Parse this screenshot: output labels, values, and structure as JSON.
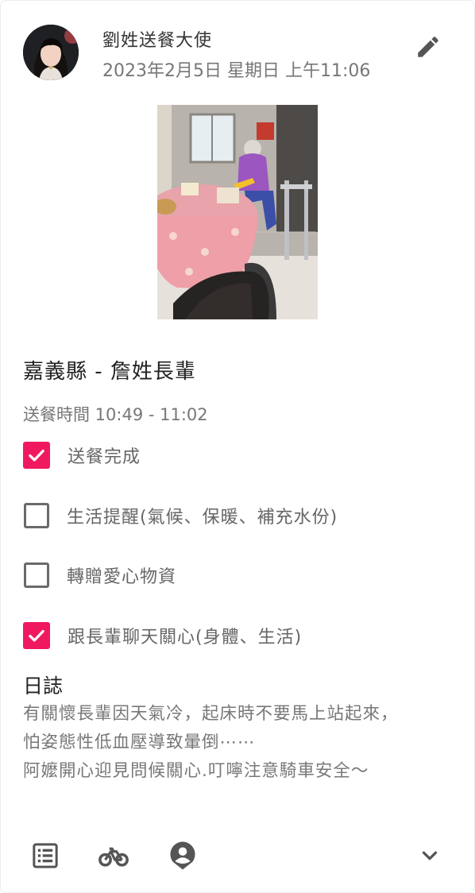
{
  "post": {
    "author": "劉姓送餐大使",
    "date": "2023年2月5日 星期日 上午11:06",
    "title": "嘉義縣 - 詹姓長輩",
    "delivery_time": "送餐時間 10:49 - 11:02"
  },
  "tasks": [
    {
      "label": "送餐完成",
      "checked": true
    },
    {
      "label": "生活提醒(氣候、保暖、補充水份)",
      "checked": false
    },
    {
      "label": "轉贈愛心物資",
      "checked": false
    },
    {
      "label": "跟長輩聊天關心(身體、生活)",
      "checked": true
    }
  ],
  "notes": {
    "heading": "日誌",
    "lines": [
      "有關懷長輩因天氣冷，起床時不要馬上站起來，",
      "怕姿態性低血壓導致暈倒⋯⋯",
      "阿嬤開心迎見問候關心.叮嚀注意騎車安全～"
    ]
  },
  "footer": {
    "icons": [
      "list-icon",
      "bicycle-icon",
      "person-pin-icon",
      "chevron-down-icon"
    ]
  },
  "colors": {
    "accent": "#f0195f",
    "text_primary": "#222222",
    "text_secondary": "#777777",
    "icon": "#555555"
  }
}
